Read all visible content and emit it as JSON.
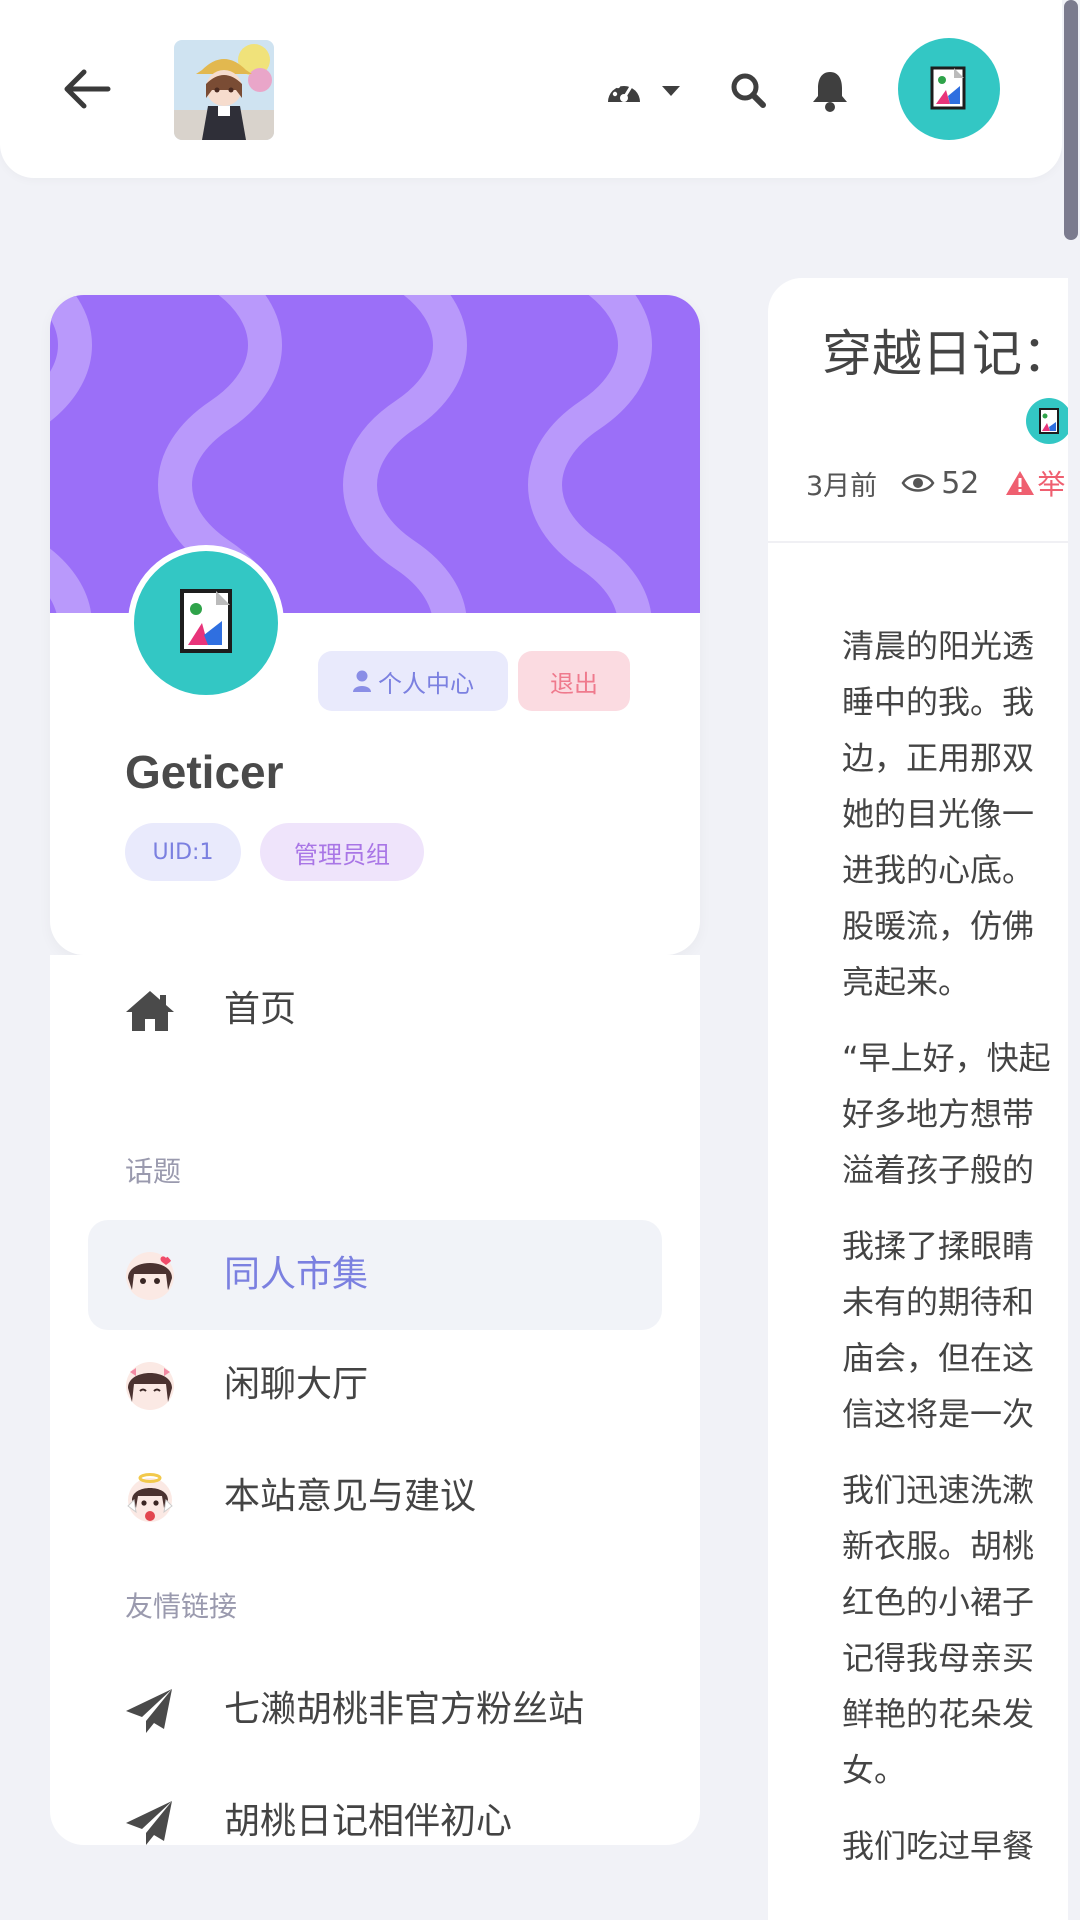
{
  "header": {
    "icons": [
      "arrow-left-icon",
      "dashboard-icon",
      "caret-down-icon",
      "search-icon",
      "bell-icon"
    ]
  },
  "profile": {
    "username": "Geticer",
    "center_label": "个人中心",
    "logout_label": "退出",
    "uid_badge": "UID:1",
    "group_badge": "管理员组",
    "banner_color": "#9b6ff8",
    "avatar_color": "#33c7c4"
  },
  "nav": {
    "home": "首页",
    "section_topics": "话题",
    "topics": [
      "同人市集",
      "闲聊大厅",
      "本站意见与建议"
    ],
    "active_topic": "同人市集",
    "section_links": "友情链接",
    "links": [
      "七濑胡桃非官方粉丝站",
      "胡桃日记相伴初心"
    ]
  },
  "post": {
    "title": "穿越日记：",
    "time": "3月前",
    "views": "52",
    "report_label": "举",
    "paragraphs": [
      [
        "清晨的阳光透",
        "睡中的我。我",
        "边，正用那双",
        "她的目光像一",
        "进我的心底。",
        "股暖流，仿佛",
        "亮起来。"
      ],
      [
        "“早上好，快起",
        "好多地方想带",
        "溢着孩子般的"
      ],
      [
        "我揉了揉眼睛",
        "未有的期待和",
        "庙会，但在这",
        "信这将是一次"
      ],
      [
        "我们迅速洗漱",
        "新衣服。胡桃",
        "红色的小裙子",
        "记得我母亲买",
        "鲜艳的花朵发",
        "女。"
      ],
      [
        "我们吃过早餐"
      ]
    ]
  },
  "colors": {
    "accent": "#7b80e0",
    "danger": "#ef5f70",
    "background": "#f1f2f7"
  }
}
